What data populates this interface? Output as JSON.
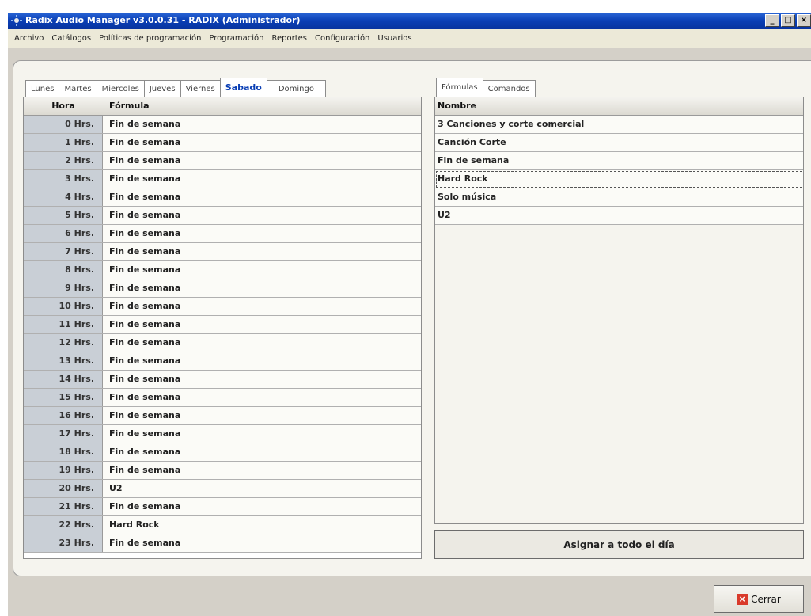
{
  "window": {
    "title": "Radix Audio Manager v3.0.0.31 - RADIX (Administrador)",
    "controls": [
      "_",
      "□",
      "×"
    ]
  },
  "menu": [
    "Archivo",
    "Catálogos",
    "Políticas de programación",
    "Programación",
    "Reportes",
    "Configuración",
    "Usuarios"
  ],
  "day_tabs": [
    "Lunes",
    "Martes",
    "Miercoles",
    "Jueves",
    "Viernes",
    "Sabado",
    "Domingo"
  ],
  "active_day": "Sabado",
  "schedule": {
    "headers": {
      "hora": "Hora",
      "formula": "Fórmula"
    },
    "rows": [
      {
        "hora": "0  Hrs.",
        "formula": "Fin de semana"
      },
      {
        "hora": "1  Hrs.",
        "formula": "Fin de semana"
      },
      {
        "hora": "2  Hrs.",
        "formula": "Fin de semana"
      },
      {
        "hora": "3  Hrs.",
        "formula": "Fin de semana"
      },
      {
        "hora": "4  Hrs.",
        "formula": "Fin de semana"
      },
      {
        "hora": "5  Hrs.",
        "formula": "Fin de semana"
      },
      {
        "hora": "6  Hrs.",
        "formula": "Fin de semana"
      },
      {
        "hora": "7  Hrs.",
        "formula": "Fin de semana"
      },
      {
        "hora": "8  Hrs.",
        "formula": "Fin de semana"
      },
      {
        "hora": "9  Hrs.",
        "formula": "Fin de semana"
      },
      {
        "hora": "10 Hrs.",
        "formula": "Fin de semana"
      },
      {
        "hora": "11 Hrs.",
        "formula": "Fin de semana"
      },
      {
        "hora": "12 Hrs.",
        "formula": "Fin de semana"
      },
      {
        "hora": "13 Hrs.",
        "formula": "Fin de semana"
      },
      {
        "hora": "14 Hrs.",
        "formula": "Fin de semana"
      },
      {
        "hora": "15 Hrs.",
        "formula": "Fin de semana"
      },
      {
        "hora": "16 Hrs.",
        "formula": "Fin de semana"
      },
      {
        "hora": "17 Hrs.",
        "formula": "Fin de semana"
      },
      {
        "hora": "18 Hrs.",
        "formula": "Fin de semana"
      },
      {
        "hora": "19 Hrs.",
        "formula": "Fin de semana"
      },
      {
        "hora": "20 Hrs.",
        "formula": "U2"
      },
      {
        "hora": "21 Hrs.",
        "formula": "Fin de semana"
      },
      {
        "hora": "22 Hrs.",
        "formula": "Hard Rock"
      },
      {
        "hora": "23 Hrs.",
        "formula": "Fin de semana"
      }
    ]
  },
  "right_tabs": [
    "Fórmulas",
    "Comandos"
  ],
  "active_right_tab": "Fórmulas",
  "formula_list": {
    "header": "Nombre",
    "items": [
      "3 Canciones y corte comercial",
      "Canción Corte",
      "Fin de semana",
      "Hard Rock",
      "Solo música",
      "U2"
    ],
    "selected": "Hard Rock"
  },
  "buttons": {
    "assign": "Asignar a todo el día",
    "close": "Cerrar"
  },
  "colors": {
    "titlebar": "#0a3fb5",
    "active_tab": "#0a3fb5",
    "hora_cell": "#c9cfd6",
    "close_icon": "#d93a2b"
  }
}
